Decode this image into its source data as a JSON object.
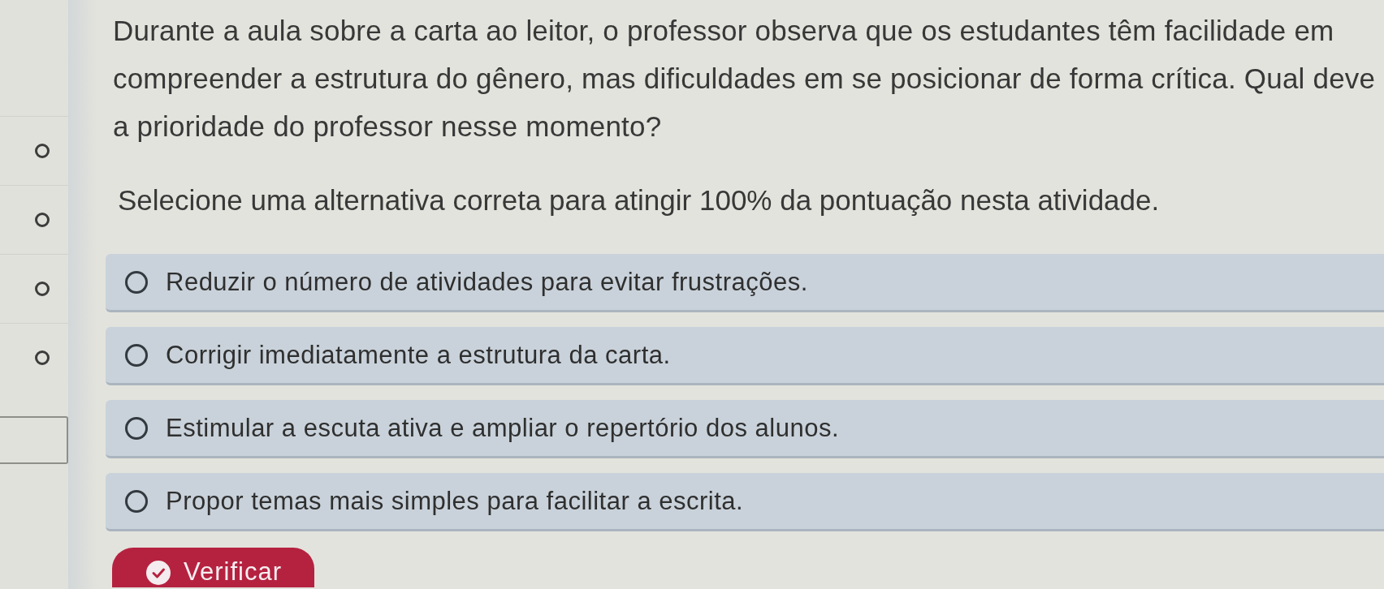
{
  "sidebar": {
    "steps": [
      {
        "completed": false
      },
      {
        "completed": false
      },
      {
        "completed": false
      },
      {
        "completed": false
      }
    ]
  },
  "question": {
    "text": "Durante a aula sobre a carta ao leitor, o professor observa que os estudantes têm facilidade em compreender a estrutura do gênero, mas dificuldades em se posicionar de forma crítica. Qual deve a prioridade do professor nesse momento?",
    "instruction": "Selecione uma alternativa correta para atingir 100% da pontuação nesta atividade."
  },
  "options": [
    {
      "label": "Reduzir o número de atividades para evitar frustrações.",
      "selected": false
    },
    {
      "label": "Corrigir imediatamente a estrutura da carta.",
      "selected": false
    },
    {
      "label": "Estimular a escuta ativa e ampliar o repertório dos alunos.",
      "selected": false
    },
    {
      "label": "Propor temas mais simples para facilitar a escrita.",
      "selected": false
    }
  ],
  "submit_button": {
    "label": "Verificar"
  }
}
